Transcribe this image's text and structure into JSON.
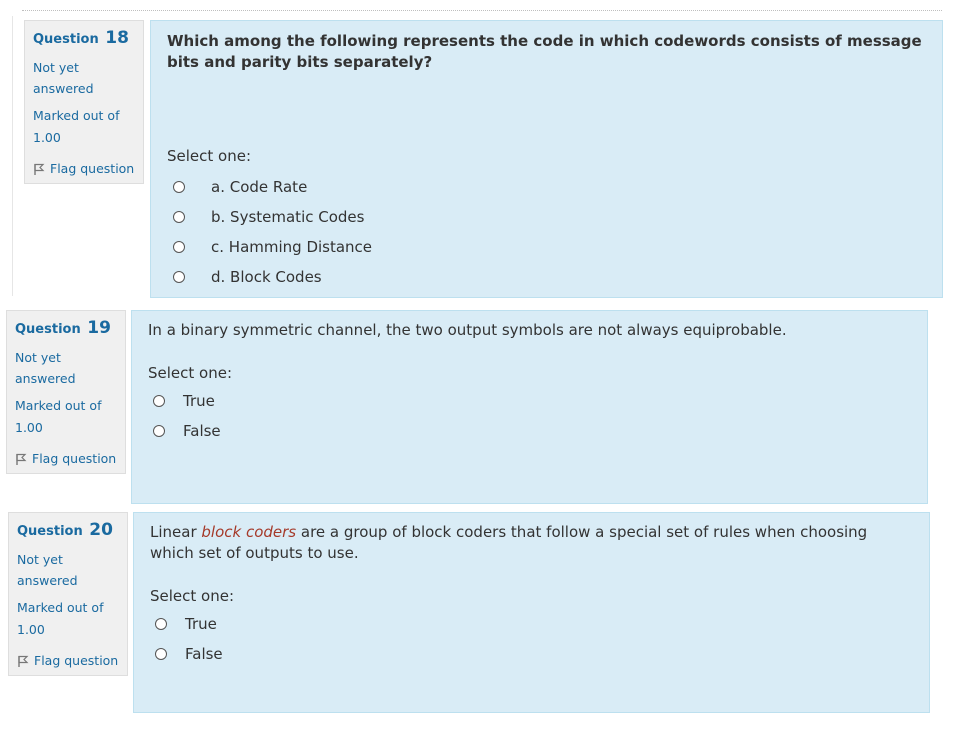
{
  "questions": [
    {
      "question_label": "Question",
      "number": "18",
      "state": "Not yet answered",
      "marked": "Marked out of 1.00",
      "flag_label": "Flag question",
      "text": "Which among the following represents the code in which codewords consists of message bits and parity bits separately?",
      "prompt": "Select one:",
      "options": [
        "a. Code Rate",
        "b. Systematic Codes",
        "c. Hamming Distance",
        "d. Block Codes"
      ]
    },
    {
      "question_label": "Question",
      "number": "19",
      "state": "Not yet answered",
      "marked": "Marked out of 1.00",
      "flag_label": "Flag question",
      "text": "In a binary symmetric channel, the two output symbols are not always equiprobable.",
      "prompt": "Select one:",
      "options": [
        "True",
        "False"
      ]
    },
    {
      "question_label": "Question",
      "number": "20",
      "state": "Not yet answered",
      "marked": "Marked out of 1.00",
      "flag_label": "Flag question",
      "text_before": "Linear ",
      "text_highlight": "block coders",
      "text_after": " are a group of block coders that follow a special set of rules when choosing which set of outputs to use.",
      "prompt": "Select one:",
      "options": [
        "True",
        "False"
      ]
    }
  ],
  "icons": {
    "flag": "flag-icon",
    "radio": "radio-button-icon"
  },
  "colors": {
    "link": "#1a6aa0",
    "content_bg": "#d9ecf6",
    "info_bg": "#f0f0f0",
    "highlight": "#a53a2a"
  }
}
